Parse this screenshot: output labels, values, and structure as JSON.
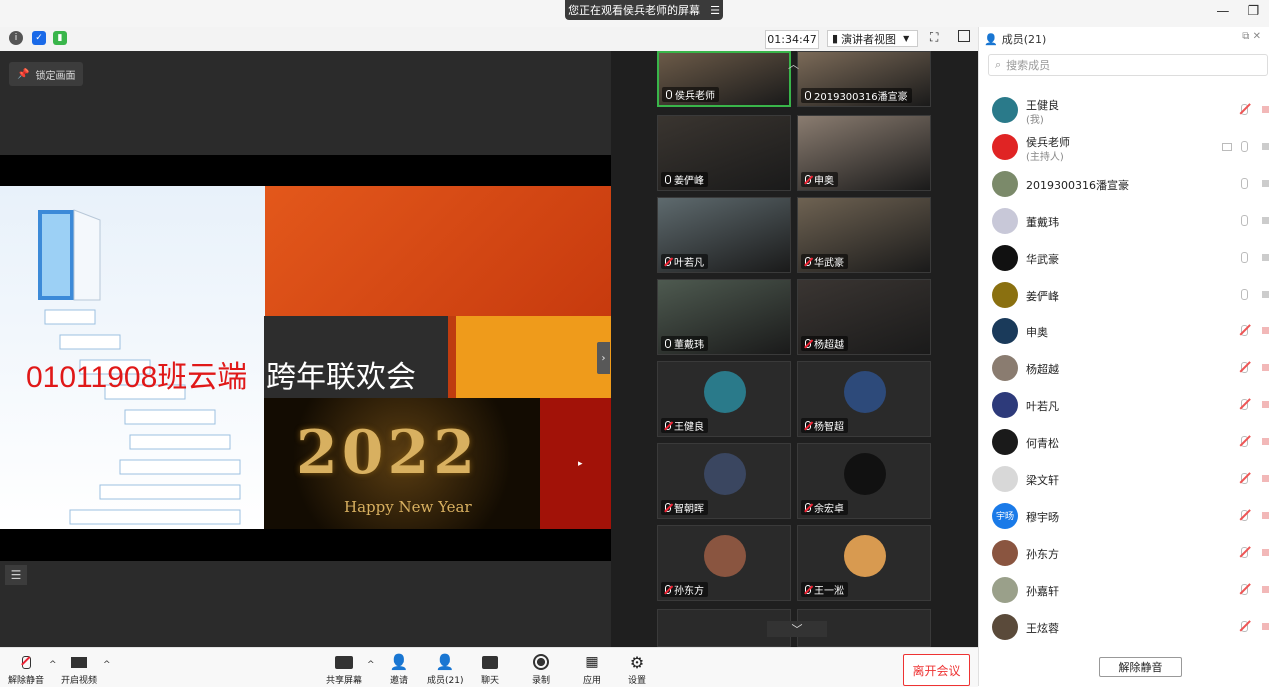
{
  "window": {
    "share_banner": "您正在观看侯兵老师的屏幕",
    "banner_menu_icon": "menu-icon"
  },
  "toolbar": {
    "timer": "01:34:47",
    "view_mode": "演讲者视图"
  },
  "share": {
    "lock_label": "锁定画面",
    "slide_title_red": "01011908班云端",
    "slide_title_white": "跨年联欢会",
    "ny_year": "2022",
    "ny_text": "Happy New Year"
  },
  "gallery": {
    "tiles": [
      {
        "name": "侯兵老师",
        "muted": false,
        "color": "#6b5a48",
        "active": true
      },
      {
        "name": "2019300316潘宣豪",
        "muted": false,
        "color": "#7b6a58"
      },
      {
        "name": "姜俨峰",
        "muted": false,
        "color": "#3a3530"
      },
      {
        "name": "申奥",
        "muted": true,
        "color": "#8a7c70"
      },
      {
        "name": "叶若凡",
        "muted": true,
        "color": "#5e6a6e"
      },
      {
        "name": "华武豪",
        "muted": true,
        "color": "#6e6252"
      },
      {
        "name": "董戴玮",
        "muted": false,
        "color": "#4e5a50"
      },
      {
        "name": "杨超越",
        "muted": true,
        "color": "#3a3532"
      },
      {
        "name": "王健良",
        "muted": true,
        "color": "#2a2a2a",
        "avatar": "#2a7a8a"
      },
      {
        "name": "杨智超",
        "muted": true,
        "color": "#2a2a2a",
        "avatar": "#2d4a7a"
      },
      {
        "name": "智朝晖",
        "muted": true,
        "color": "#2a2a2a",
        "avatar": "#3a4660"
      },
      {
        "name": "余宏卓",
        "muted": true,
        "color": "#2a2a2a",
        "avatar": "#111111"
      },
      {
        "name": "孙东方",
        "muted": true,
        "color": "#2a2a2a",
        "avatar": "#8a5540"
      },
      {
        "name": "王一淞",
        "muted": true,
        "color": "#2a2a2a",
        "avatar": "#d89a50"
      }
    ]
  },
  "members": {
    "title": "成员(21)",
    "search_placeholder": "搜索成员",
    "list": [
      {
        "name": "王健良",
        "sub": "(我)",
        "muted": true,
        "cam_red": true,
        "color": "#2a7a8a"
      },
      {
        "name": "侯兵老师",
        "sub": "(主持人)",
        "muted": false,
        "cam_red": false,
        "screen": true,
        "color": "#e02424"
      },
      {
        "name": "2019300316潘宣豪",
        "sub": "",
        "muted": false,
        "cam_red": false,
        "color": "#7b8a6a"
      },
      {
        "name": "董戴玮",
        "sub": "",
        "muted": false,
        "cam_red": false,
        "color": "#c8c8d8"
      },
      {
        "name": "华武豪",
        "sub": "",
        "muted": false,
        "cam_red": false,
        "color": "#111111"
      },
      {
        "name": "姜俨峰",
        "sub": "",
        "muted": false,
        "cam_red": false,
        "color": "#8a7010"
      },
      {
        "name": "申奥",
        "sub": "",
        "muted": true,
        "cam_red": true,
        "color": "#1a3a5a"
      },
      {
        "name": "杨超越",
        "sub": "",
        "muted": true,
        "cam_red": true,
        "color": "#8a7c70"
      },
      {
        "name": "叶若凡",
        "sub": "",
        "muted": true,
        "cam_red": true,
        "color": "#2d3a7a"
      },
      {
        "name": "何青松",
        "sub": "",
        "muted": true,
        "cam_red": true,
        "color": "#1a1a1a"
      },
      {
        "name": "梁文轩",
        "sub": "",
        "muted": true,
        "cam_red": true,
        "color": "#d8d8d8"
      },
      {
        "name": "穆宇旸",
        "sub": "",
        "muted": true,
        "cam_red": true,
        "color": "#1a7ae8",
        "initials": "宇旸"
      },
      {
        "name": "孙东方",
        "sub": "",
        "muted": true,
        "cam_red": true,
        "color": "#8a5540"
      },
      {
        "name": "孙嘉轩",
        "sub": "",
        "muted": true,
        "cam_red": true,
        "color": "#9aa08a"
      },
      {
        "name": "王炫蓉",
        "sub": "",
        "muted": true,
        "cam_red": true,
        "color": "#5a4a3a"
      }
    ],
    "unmute_all": "解除静音"
  },
  "bottom_bar": {
    "unmute": "解除静音",
    "start_video": "开启视频",
    "share_screen": "共享屏幕",
    "invite": "邀请",
    "members": "成员(21)",
    "chat": "聊天",
    "record": "录制",
    "apps": "应用",
    "settings": "设置",
    "leave": "离开会议"
  }
}
